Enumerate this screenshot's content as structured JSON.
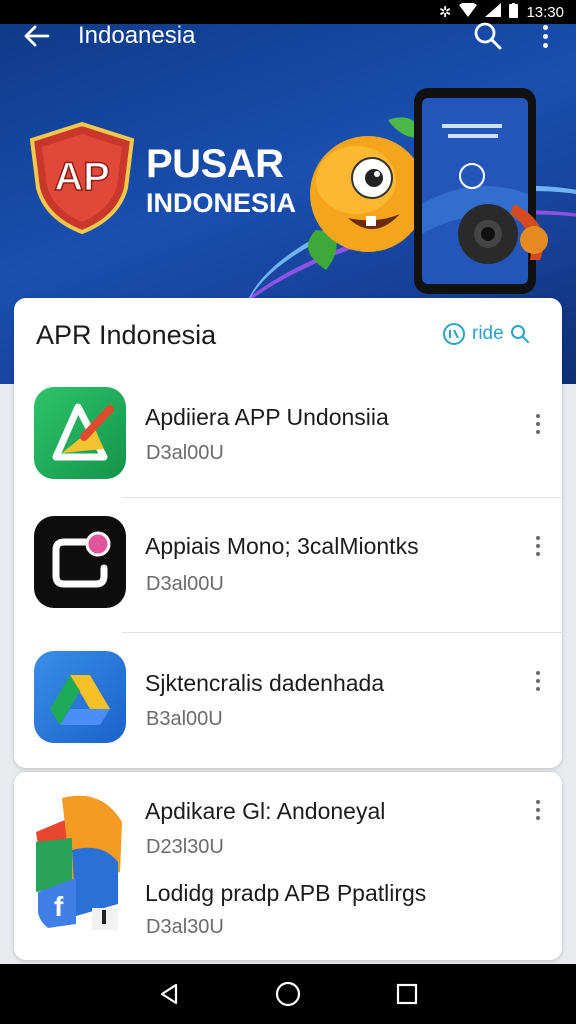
{
  "status_bar": {
    "time": "13:30"
  },
  "header": {
    "title": "Indoanesia"
  },
  "banner": {
    "logo_text": "AP",
    "line1": "PUSAR",
    "line2": "INDONESIA"
  },
  "list_card": {
    "title": "APR Indonesia",
    "hide_label": "ride",
    "items": [
      {
        "name": "Apdiiera APP Undonsiia",
        "meta": "D3al00U",
        "icon": "app-builder-icon"
      },
      {
        "name": "Appiais Mono; 3calMiontks",
        "meta": "D3al00U",
        "icon": "camera-app-icon"
      },
      {
        "name": "Sjktencralis dadenhada",
        "meta": "B3al00U",
        "icon": "drive-icon"
      }
    ]
  },
  "second_card": {
    "items": [
      {
        "name": "Apdikare Gl: Andoneyal",
        "meta": "D23l30U",
        "icon": "app-collage-icon"
      },
      {
        "name": "Lodidg pradp APB Ppatlirgs",
        "meta": "D3al30U"
      }
    ]
  },
  "colors": {
    "accent": "#2aa3c9",
    "hero_blue": "#1a4fb0"
  }
}
